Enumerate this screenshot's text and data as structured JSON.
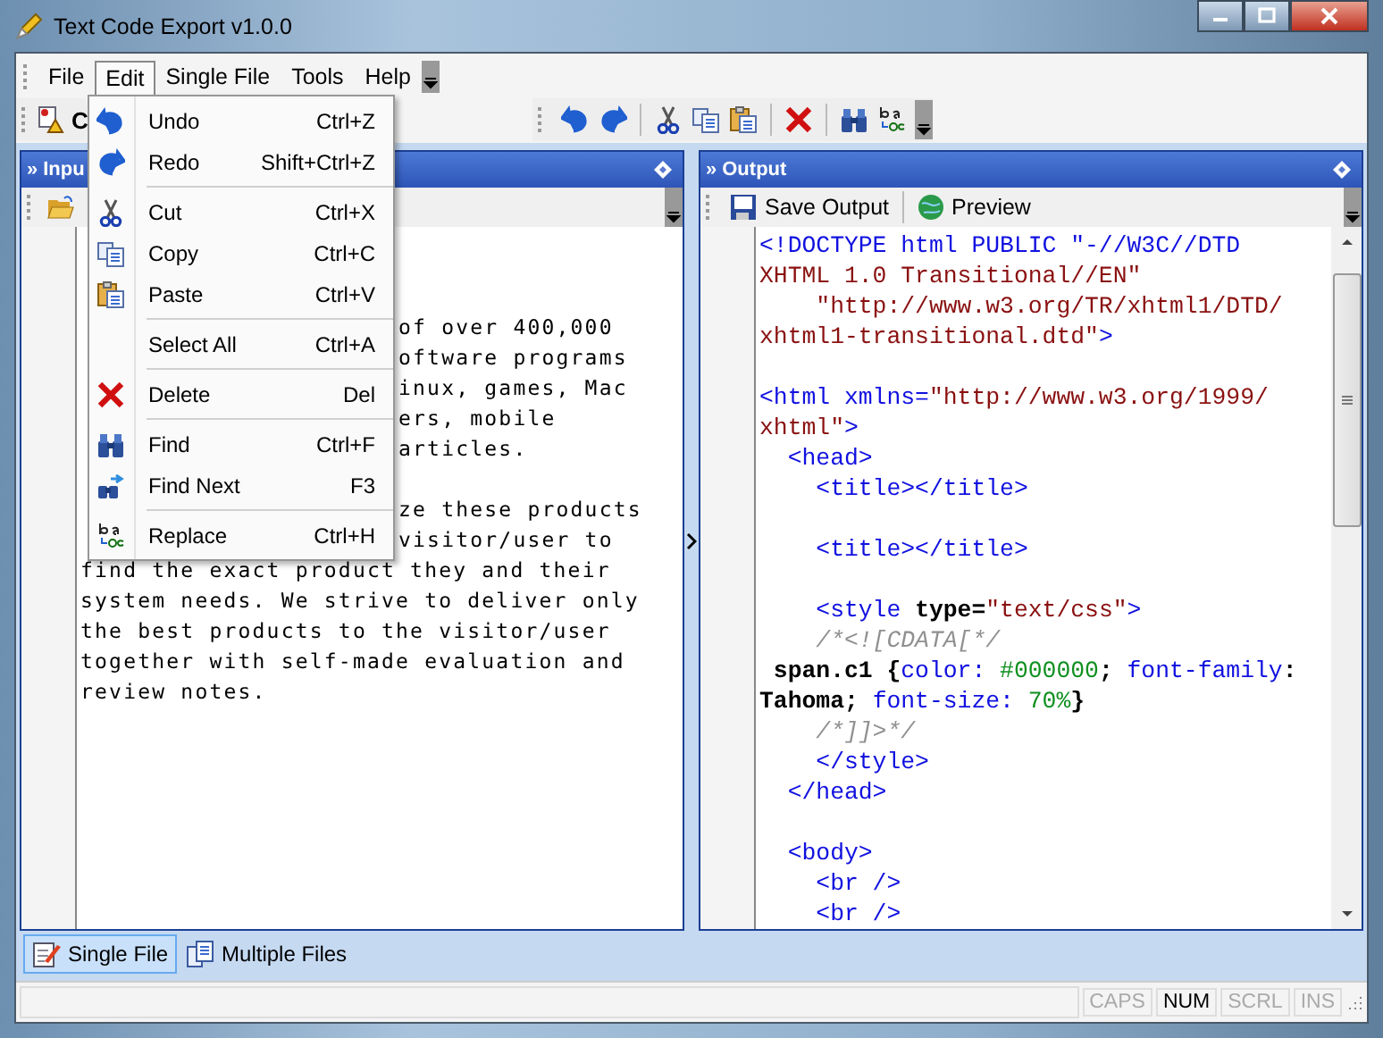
{
  "window": {
    "title": "Text Code Export v1.0.0"
  },
  "menu_bar": [
    {
      "label": "File",
      "selected": false
    },
    {
      "label": "Edit",
      "selected": true
    },
    {
      "label": "Single File",
      "selected": false
    },
    {
      "label": "Tools",
      "selected": false
    },
    {
      "label": "Help",
      "selected": false
    }
  ],
  "main_toolbar": {
    "label": "C"
  },
  "edit_menu": [
    {
      "label": "Undo",
      "shortcut": "Ctrl+Z",
      "separator_after": false
    },
    {
      "label": "Redo",
      "shortcut": "Shift+Ctrl+Z",
      "separator_after": true
    },
    {
      "label": "Cut",
      "shortcut": "Ctrl+X",
      "separator_after": false
    },
    {
      "label": "Copy",
      "shortcut": "Ctrl+C",
      "separator_after": false
    },
    {
      "label": "Paste",
      "shortcut": "Ctrl+V",
      "separator_after": true
    },
    {
      "label": "Select All",
      "shortcut": "Ctrl+A",
      "separator_after": true
    },
    {
      "label": "Delete",
      "shortcut": "Del",
      "separator_after": true
    },
    {
      "label": "Find",
      "shortcut": "Ctrl+F",
      "separator_after": false
    },
    {
      "label": "Find Next",
      "shortcut": "F3",
      "separator_after": true
    },
    {
      "label": "Replace",
      "shortcut": "Ctrl+H",
      "separator_after": false
    }
  ],
  "input_panel": {
    "marker": "»",
    "title": "Inpu",
    "lines": [
      {
        "kind": "partial",
        "text": "of over 400,000"
      },
      {
        "kind": "partial",
        "text": "oftware programs"
      },
      {
        "kind": "partial",
        "text": "inux, games, Mac"
      },
      {
        "kind": "partial",
        "text": "ers, mobile"
      },
      {
        "kind": "partial",
        "text": "articles."
      },
      {
        "kind": "blank"
      },
      {
        "kind": "partial",
        "text": "ze these products"
      },
      {
        "kind": "partial",
        "text": "visitor/user to"
      },
      {
        "kind": "full",
        "text": "find the exact product they and their"
      },
      {
        "kind": "full",
        "text": "system needs. We strive to deliver only"
      },
      {
        "kind": "full",
        "text": "the best products to the visitor/user"
      },
      {
        "kind": "full",
        "text": "together with self-made evaluation and"
      },
      {
        "kind": "full",
        "text": "review notes."
      }
    ]
  },
  "output_panel": {
    "marker": "»",
    "title": "Output",
    "toolbar": [
      {
        "label": "Save Output"
      },
      {
        "label": "Preview"
      }
    ],
    "code": [
      {
        "kind": "code",
        "segments": [
          {
            "kind": "tag",
            "text": "<!DOCTYPE html PUBLIC \"-//W3C//DTD"
          }
        ]
      },
      {
        "kind": "code",
        "segments": [
          {
            "kind": "string",
            "text": "XHTML 1.0 Transitional//EN\""
          }
        ]
      },
      {
        "kind": "code",
        "segments": [
          {
            "kind": "string",
            "text": "    \"http://www.w3.org/TR/xhtml1/DTD/"
          }
        ]
      },
      {
        "kind": "code",
        "segments": [
          {
            "kind": "string",
            "text": "xhtml1-transitional.dtd\""
          },
          {
            "kind": "tag",
            "text": ">"
          }
        ]
      },
      {
        "kind": "blank"
      },
      {
        "kind": "code",
        "segments": [
          {
            "kind": "tag",
            "text": "<html xmlns="
          },
          {
            "kind": "string",
            "text": "\"http://www.w3.org/1999/"
          }
        ]
      },
      {
        "kind": "code",
        "segments": [
          {
            "kind": "string",
            "text": "xhtml\""
          },
          {
            "kind": "tag",
            "text": ">"
          }
        ]
      },
      {
        "kind": "code",
        "segments": [
          {
            "kind": "tag",
            "text": "  <head>"
          }
        ]
      },
      {
        "kind": "code",
        "segments": [
          {
            "kind": "tag",
            "text": "    <title></title>"
          }
        ]
      },
      {
        "kind": "blank"
      },
      {
        "kind": "code",
        "segments": [
          {
            "kind": "tag",
            "text": "    <title></title>"
          }
        ]
      },
      {
        "kind": "blank"
      },
      {
        "kind": "code",
        "segments": [
          {
            "kind": "tag",
            "text": "    <style "
          },
          {
            "kind": "plain",
            "text": "type="
          },
          {
            "kind": "string",
            "text": "\"text/css\""
          },
          {
            "kind": "tag",
            "text": ">"
          }
        ]
      },
      {
        "kind": "code",
        "segments": [
          {
            "kind": "comment",
            "text": "    /*<![CDATA[*/"
          }
        ]
      },
      {
        "kind": "code",
        "segments": [
          {
            "kind": "plain",
            "text": " span.c1 {"
          },
          {
            "kind": "tag",
            "text": "color:"
          },
          {
            "kind": "number",
            "text": " #000000"
          },
          {
            "kind": "plain",
            "text": "; "
          },
          {
            "kind": "tag",
            "text": "font-family"
          },
          {
            "kind": "plain",
            "text": ":"
          }
        ]
      },
      {
        "kind": "code",
        "segments": [
          {
            "kind": "plain",
            "text": "Tahoma; "
          },
          {
            "kind": "tag",
            "text": "font-size:"
          },
          {
            "kind": "number",
            "text": " 70%"
          },
          {
            "kind": "plain",
            "text": "}"
          }
        ]
      },
      {
        "kind": "code",
        "segments": [
          {
            "kind": "comment",
            "text": "    /*]]>*/"
          }
        ]
      },
      {
        "kind": "code",
        "segments": [
          {
            "kind": "tag",
            "text": "    </style>"
          }
        ]
      },
      {
        "kind": "code",
        "segments": [
          {
            "kind": "tag",
            "text": "  </head>"
          }
        ]
      },
      {
        "kind": "blank"
      },
      {
        "kind": "code",
        "segments": [
          {
            "kind": "tag",
            "text": "  <body>"
          }
        ]
      },
      {
        "kind": "code",
        "segments": [
          {
            "kind": "tag",
            "text": "    <br />"
          }
        ]
      },
      {
        "kind": "code",
        "segments": [
          {
            "kind": "tag",
            "text": "    <br />"
          }
        ]
      }
    ]
  },
  "tabs": [
    {
      "label": "Single File",
      "selected": true
    },
    {
      "label": "Multiple Files",
      "selected": false
    }
  ],
  "status_bar": [
    {
      "label": "CAPS",
      "on": false
    },
    {
      "label": "NUM",
      "on": true
    },
    {
      "label": "SCRL",
      "on": false
    },
    {
      "label": "INS",
      "on": false
    }
  ]
}
